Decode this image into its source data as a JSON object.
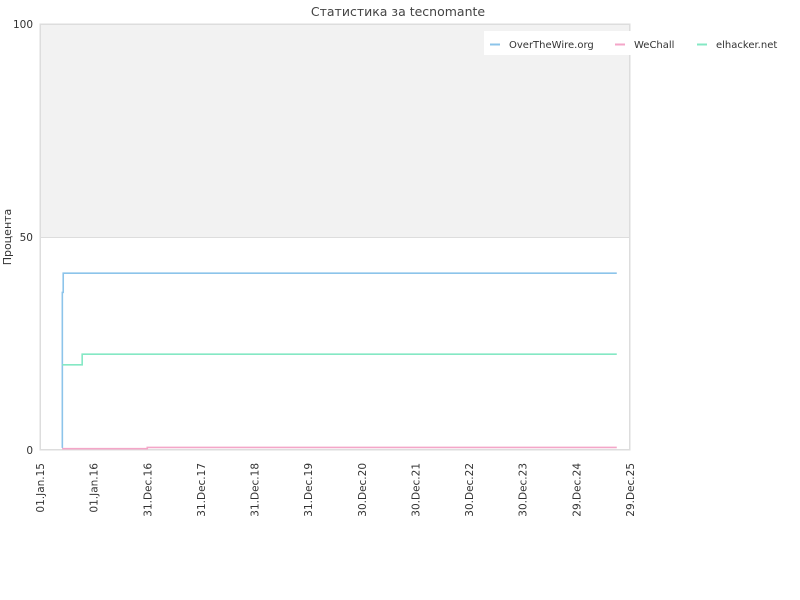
{
  "chart_data": {
    "type": "line",
    "step": true,
    "title": "Статистика за tecnomante",
    "xlabel": "",
    "ylabel": "Процента",
    "ylim": [
      0,
      100
    ],
    "y_ticks": [
      "0",
      "50",
      "100"
    ],
    "x_range": [
      "2015-01-01",
      "2025-12-29"
    ],
    "x_ticks": [
      {
        "date": "2015-01-01",
        "label": "01.Jan.15"
      },
      {
        "date": "2016-01-01",
        "label": "01.Jan.16"
      },
      {
        "date": "2016-12-31",
        "label": "31.Dec.16"
      },
      {
        "date": "2017-12-31",
        "label": "31.Dec.17"
      },
      {
        "date": "2018-12-31",
        "label": "31.Dec.18"
      },
      {
        "date": "2019-12-31",
        "label": "31.Dec.19"
      },
      {
        "date": "2020-12-30",
        "label": "30.Dec.20"
      },
      {
        "date": "2021-12-30",
        "label": "30.Dec.21"
      },
      {
        "date": "2022-12-30",
        "label": "30.Dec.22"
      },
      {
        "date": "2023-12-30",
        "label": "30.Dec.23"
      },
      {
        "date": "2024-12-29",
        "label": "29.Dec.24"
      },
      {
        "date": "2025-12-29",
        "label": "29.Dec.25"
      }
    ],
    "legend_position": "top-right",
    "grid": false,
    "background_band": {
      "from": 50,
      "to": 100,
      "color": "#f2f2f2"
    },
    "series": [
      {
        "name": "OverTheWire.org",
        "color": "#8cc4ea",
        "points": [
          {
            "date": "2015-06-01",
            "value": 0.5
          },
          {
            "date": "2015-06-02",
            "value": 37
          },
          {
            "date": "2015-06-08",
            "value": 41.5
          },
          {
            "date": "2025-09-30",
            "value": 41.5
          }
        ]
      },
      {
        "name": "WeChall",
        "color": "#f4a6c8",
        "points": [
          {
            "date": "2015-06-01",
            "value": 0.3
          },
          {
            "date": "2016-12-31",
            "value": 0.6
          },
          {
            "date": "2025-09-30",
            "value": 0.6
          }
        ]
      },
      {
        "name": "elhacker.net",
        "color": "#84e8c4",
        "points": [
          {
            "date": "2015-06-01",
            "value": 20
          },
          {
            "date": "2015-10-15",
            "value": 22.5
          },
          {
            "date": "2025-09-30",
            "value": 22.5
          }
        ]
      }
    ]
  }
}
